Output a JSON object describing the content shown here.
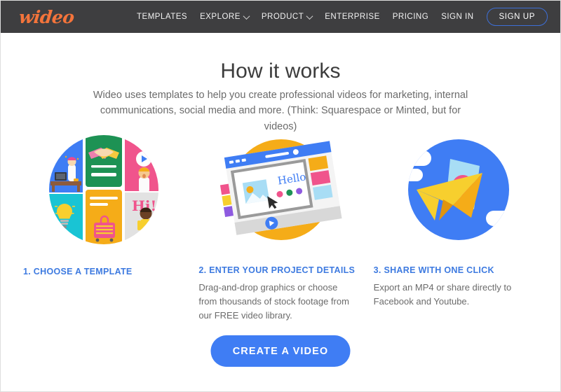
{
  "navbar": {
    "logo": "wideo",
    "links": [
      {
        "label": "TEMPLATES",
        "has_chevron": false,
        "icon": null
      },
      {
        "label": "EXPLORE",
        "has_chevron": true,
        "icon": "chevron-down-icon"
      },
      {
        "label": "PRODUCT",
        "has_chevron": true,
        "icon": "chevron-down-icon"
      },
      {
        "label": "ENTERPRISE",
        "has_chevron": false,
        "icon": null
      },
      {
        "label": "PRICING",
        "has_chevron": false,
        "icon": null
      },
      {
        "label": "SIGN IN",
        "has_chevron": false,
        "icon": null
      }
    ],
    "signup_label": "SIGN UP"
  },
  "hero": {
    "headline": "How it works",
    "subheadline": "Wideo uses templates to help you create professional videos for marketing, internal communications, social media and more. (Think: Squarespace or Minted, but for videos)"
  },
  "steps": [
    {
      "title": "1. CHOOSE A TEMPLATE",
      "body": "",
      "illustration": "template-grid-circle-illustration"
    },
    {
      "title": "2. ENTER YOUR PROJECT DETAILS",
      "body": "Drag-and-drop graphics or choose from thousands of stock footage from our FREE video library.",
      "illustration": "video-editor-circle-illustration"
    },
    {
      "title": "3. SHARE WITH ONE CLICK",
      "body": "Export an MP4 or share directly to Facebook and Youtube.",
      "illustration": "paper-plane-share-circle-illustration"
    }
  ],
  "illustration_text": {
    "editor_hello": "Hello",
    "template_hi": "Hi!"
  },
  "cta": {
    "label": "CREATE A VIDEO"
  },
  "colors": {
    "navbar_bg": "#3e3e40",
    "logo_orange": "#f4743b",
    "accent_blue": "#3d7ae0",
    "cta_blue": "#3f7df4",
    "signup_border": "#3d6fd8",
    "heading_text": "#3c3c3c",
    "body_text": "#6b6b6b",
    "page_bg": "#ffffff",
    "circle_yellow": "#f5ac18",
    "circle_blue": "#3f7df4"
  }
}
